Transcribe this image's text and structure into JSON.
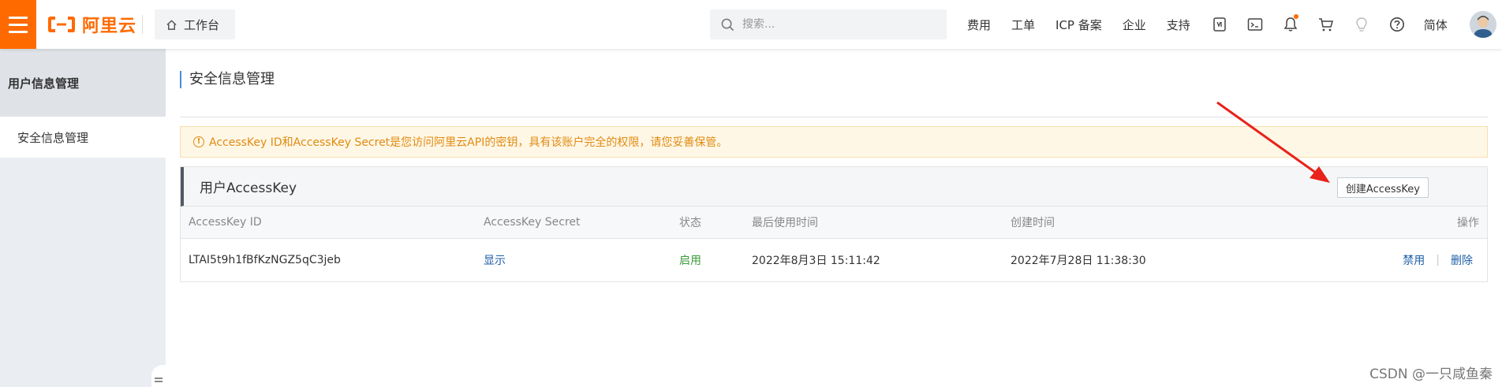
{
  "topbar": {
    "brand": "阿里云",
    "workbench_label": "工作台",
    "search_placeholder": "搜索...",
    "nav": [
      "费用",
      "工单",
      "ICP 备案",
      "企业",
      "支持"
    ],
    "lang": "简体",
    "icons": [
      "app-icon",
      "terminal-icon",
      "bell-icon",
      "cart-icon",
      "lightbulb-icon",
      "help-icon"
    ]
  },
  "sidebar": {
    "title": "用户信息管理",
    "items": [
      {
        "label": "安全信息管理",
        "active": true
      }
    ]
  },
  "main": {
    "page_title": "安全信息管理",
    "alert_text": "AccessKey ID和AccessKey Secret是您访问阿里云API的密钥，具有该账户完全的权限，请您妥善保管。",
    "panel_title": "用户AccessKey",
    "create_button": "创建AccessKey",
    "columns": [
      "AccessKey ID",
      "AccessKey Secret",
      "状态",
      "最后使用时间",
      "创建时间",
      "操作"
    ],
    "rows": [
      {
        "id": "LTAI5t9h1fBfKzNGZ5qC3jeb",
        "secret_action": "显示",
        "status": "启用",
        "last_used": "2022年8月3日 15:11:42",
        "created": "2022年7月28日 11:38:30",
        "action_disable": "禁用",
        "action_sep": "|",
        "action_delete": "删除"
      }
    ]
  },
  "watermark": "CSDN @一只咸鱼秦",
  "colors": {
    "brand": "#ff6a00",
    "link": "#1d5fa8",
    "status_on": "#3a9b39",
    "alert_text": "#e08b12",
    "annotation": "#e8231b"
  }
}
